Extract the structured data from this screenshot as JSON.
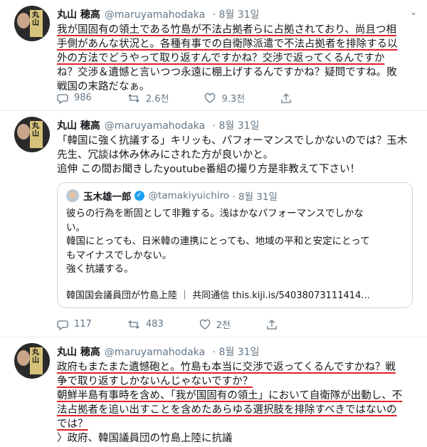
{
  "tweets": [
    {
      "name": "丸山 穂高",
      "handle": "@maruyamahodaka",
      "date": "· 8월 31일",
      "lines": [
        "我が国固有の領土である竹島が不法占拠者らに占拠されており、尚且つ相",
        "手側があんな状況と。各種有事での自衛隊派遣で不法占拠者を排除する以",
        "外の方法でどうやって取り返すんですかね？交渉で返ってくるんですか",
        "ね？交渉＆遺憾と言いつつ永遠に棚上げするんですかね？疑問ですね。敗",
        "戦国の末路だなぁ。"
      ],
      "replies": "986",
      "retweets": "2.6천",
      "likes": "9.3천"
    },
    {
      "name": "丸山 穂高",
      "handle": "@maruyamahodaka",
      "date": "· 8월 31일",
      "lines": [
        "「韓国に強く抗議する」キリッも、パフォーマンスでしかないのでは？玉木",
        "先生、冗談は休み休みにされた方が良いかと。",
        "追伸 この間お聞きしたyoutube番組の撮り方是非教えて下さい！"
      ],
      "quote": {
        "name": "玉木雄一郎",
        "handle": "@tamakiyuichiro",
        "date": "· 8월 31일",
        "lines": [
          "彼らの行為を断固として非難する。浅はかなパフォーマンスでしかな",
          "い。",
          "韓国にとっても、日米韓の連携にとっても、地域の平和と安定にとって",
          "もマイナスでしかない。",
          "強く抗議する。"
        ],
        "link": "韓国国会議員団が竹島上陸 ｜ 共同通信 this.kiji.is/54038073111414..."
      },
      "replies": "117",
      "retweets": "483",
      "likes": "2천"
    },
    {
      "name": "丸山 穂高",
      "handle": "@maruyamahodaka",
      "date": "· 8월 31일",
      "lines": [
        "政府もまたまた遺憾砲と。竹島も本当に交渉で返ってくるんですかね？戦",
        "争で取り返すしかないんじゃないですか？",
        "朝鮮半島有事時を含め、「我が国固有の領土」において自衛隊が出動し、不",
        "法占拠者を追い出すことを含めたあらゆる選択肢を排除すべきではないの",
        "では？",
        "〉政府、韓国議員団の竹島上陸に抗議"
      ]
    }
  ]
}
